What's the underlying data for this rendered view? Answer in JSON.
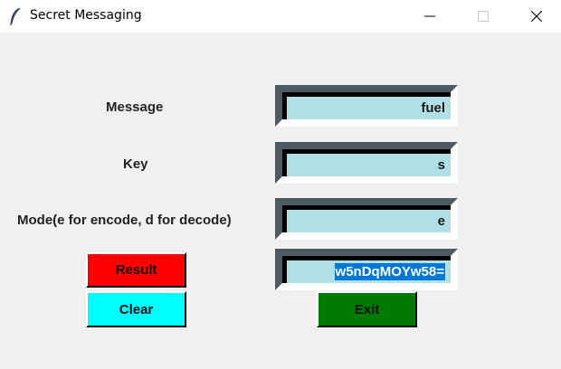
{
  "window": {
    "title": "Secret Messaging",
    "controls": [
      "minimize-icon",
      "maximize-icon",
      "close-icon"
    ]
  },
  "form": {
    "message_label": "Message",
    "message_value": "fuel",
    "key_label": "Key",
    "key_value": "s",
    "mode_label": "Mode(e for encode, d for decode)",
    "mode_value": "e",
    "result_value": "w5nDqMOYw58="
  },
  "buttons": {
    "result_label": "Result",
    "clear_label": "Clear",
    "exit_label": "Exit"
  },
  "colors": {
    "entry_background": "#b0e0e6",
    "result_button": "#ff0000",
    "clear_button": "#00ffff",
    "exit_button": "#007a00",
    "selection": "#0078d7"
  }
}
